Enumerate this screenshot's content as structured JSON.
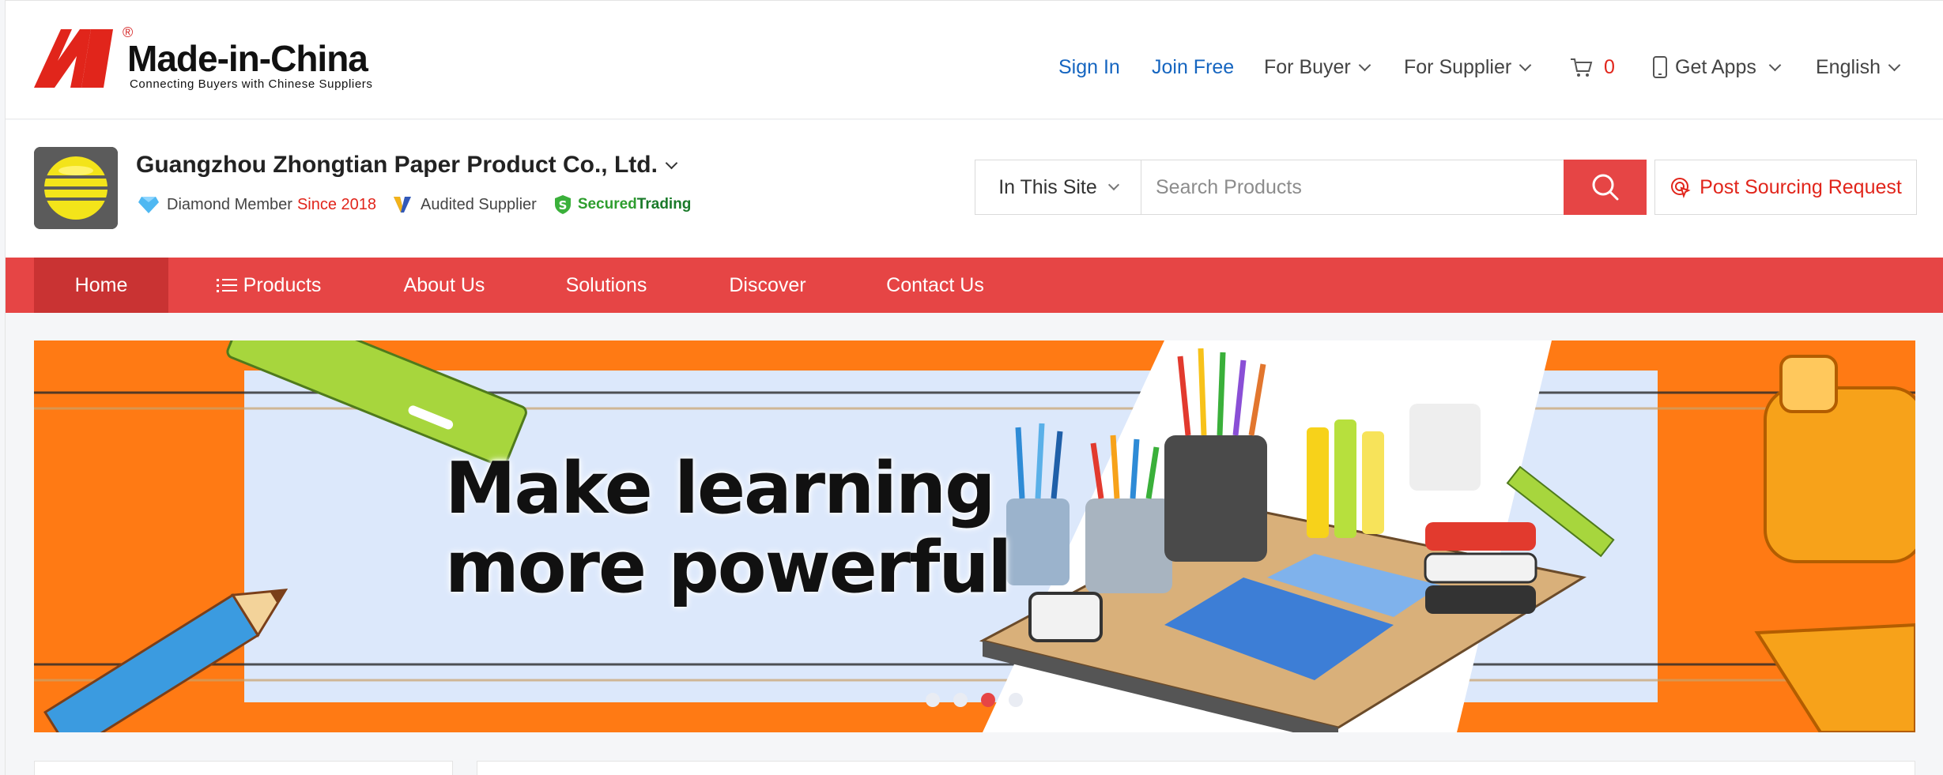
{
  "site": {
    "logo_name": "Made-in-China",
    "logo_registered": "®",
    "logo_tagline": "Connecting Buyers with Chinese Suppliers"
  },
  "topnav": {
    "sign_in": "Sign In",
    "join_free": "Join Free",
    "for_buyer": "For Buyer",
    "for_supplier": "For Supplier",
    "cart_count": "0",
    "get_apps": "Get Apps",
    "language": "English"
  },
  "company": {
    "name": "Guangzhou Zhongtian Paper Product Co., Ltd.",
    "member_label": "Diamond Member",
    "member_since": "Since 2018",
    "audited": "Audited Supplier",
    "secured_part1": "Secured",
    "secured_part2": "Trading"
  },
  "search": {
    "scope": "In This Site",
    "placeholder": "Search Products",
    "post_request": "Post Sourcing Request"
  },
  "nav": {
    "home": "Home",
    "products": "Products",
    "about": "About Us",
    "solutions": "Solutions",
    "discover": "Discover",
    "contact": "Contact Us"
  },
  "banner": {
    "line1": "Make learning",
    "line2": "more powerful",
    "slide_count": 4,
    "active_slide": 3
  },
  "colors": {
    "brand_red": "#e64545",
    "link_blue": "#1565c0",
    "banner_orange": "#ff7a14"
  }
}
